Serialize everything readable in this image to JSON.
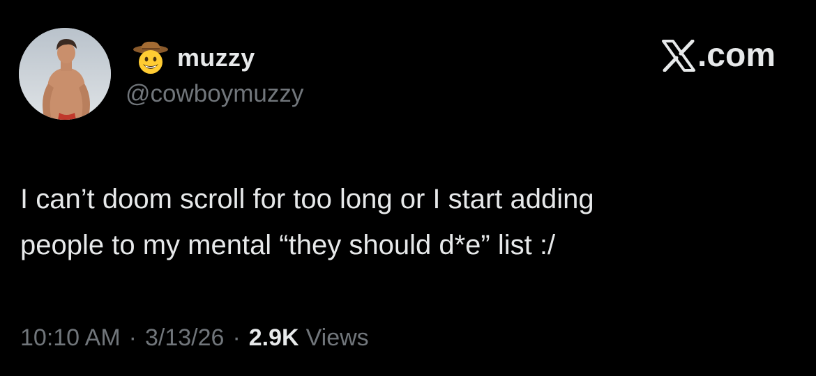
{
  "author": {
    "display_name": "muzzy",
    "handle": "@cowboymuzzy",
    "name_emoji": "cowboy-hat-face-icon"
  },
  "brand": {
    "text": ".com",
    "logo": "x-logo-icon"
  },
  "tweet": {
    "text_line1": "I can’t doom scroll for too long or I start adding",
    "text_line2": "people to my mental “they should d*e” list :/"
  },
  "meta": {
    "time": "10:10 AM",
    "separator": "·",
    "date": "3/13/26",
    "views_count": "2.9K",
    "views_label": "Views"
  },
  "colors": {
    "background": "#000000",
    "primary_text": "#e7e9ea",
    "secondary_text": "#71767b"
  }
}
